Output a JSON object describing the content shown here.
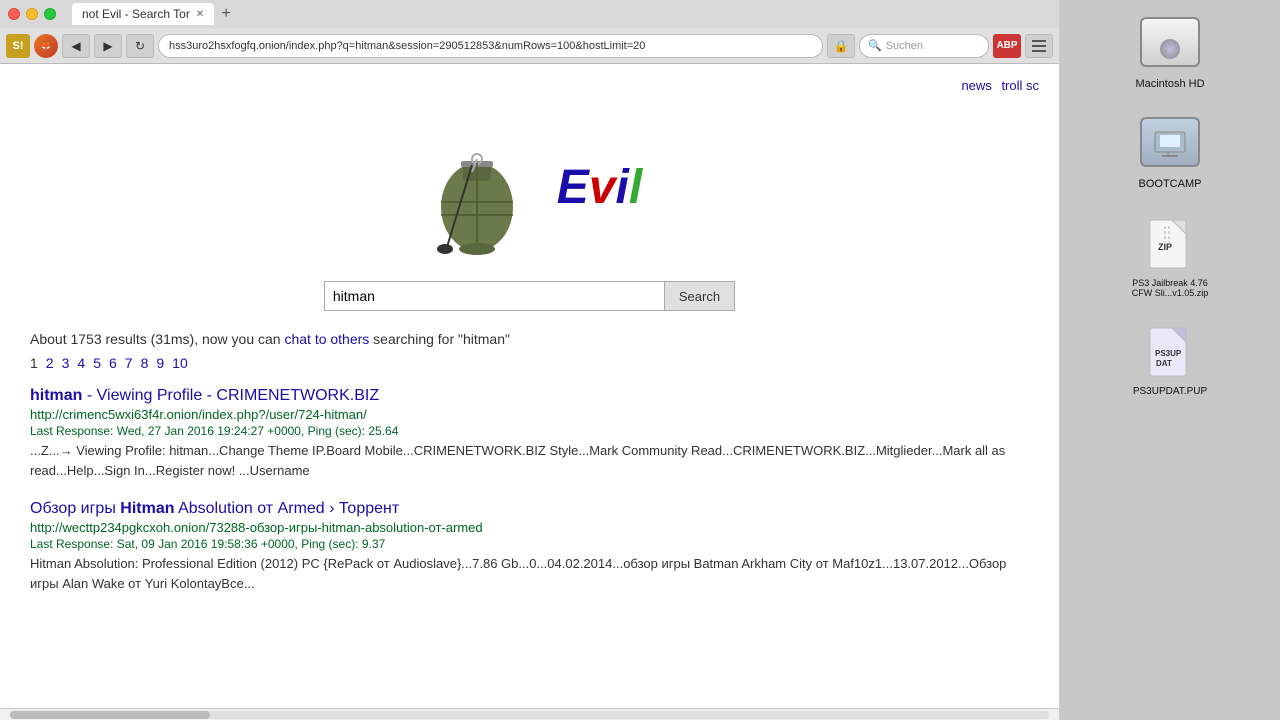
{
  "browser": {
    "title": "not Evil - Search Tor",
    "tab_label": "not Evil - Search Tor",
    "url": "hss3uro2hsxfogfq.onion/index.php?q=hitman&session=290512853&numRows=100&hostLimit=20",
    "search_placeholder": "Suchen"
  },
  "top_links": [
    "news",
    "troll sc"
  ],
  "search": {
    "query": "hitman",
    "button_label": "Search",
    "evil_letters": [
      "E",
      "v",
      "i",
      "l"
    ]
  },
  "results": {
    "summary": "About 1753 results (31ms), now you can ",
    "chat_link_text": "chat to others",
    "summary_suffix": " searching for \"hitman\"",
    "pagination": [
      "1",
      "2",
      "3",
      "4",
      "5",
      "6",
      "7",
      "8",
      "9",
      "10"
    ],
    "current_page": "1",
    "items": [
      {
        "title_highlight": "hitman",
        "title_rest": " - Viewing Profile - CRIMENETWORK.BIZ",
        "url": "http://crimenc5wxi63f4r.onion/index.php?/user/724-hitman/",
        "meta": "Last Response: Wed, 27 Jan 2016 19:24:27 +0000, Ping (sec): 25.64",
        "description": "...Z...→ Viewing Profile: hitman...Change Theme IP.Board Mobile...CRIMENETWORK.BIZ Style...Mark Community Read...CRIMENETWORK.BIZ...Mitglieder...Mark all as read...Help...Sign In...Register now! ...Username"
      },
      {
        "title_highlight": "Hitman",
        "title_prefix": "Обзор игры ",
        "title_rest": " Absolution от Armed › Торрент",
        "url": "http://wecttp234pgkcxoh.onion/73288-обзор-игры-hitman-absolution-от-armed",
        "meta": "Last Response: Sat, 09 Jan 2016 19:58:36 +0000, Ping (sec): 9.37",
        "description": "Hitman Absolution: Professional Edition (2012) PC {RePack от Audioslave}...7.86 Gb...0...04.02.2014...обзор игры Batman Arkham City от Maf10z1...13.07.2012...Обзор игры Alan Wake от Yuri KolontayВce..."
      }
    ]
  },
  "desktop": {
    "icons": [
      {
        "label": "Macintosh HD",
        "type": "hdd"
      },
      {
        "label": "BOOTCAMP",
        "type": "bootcamp"
      },
      {
        "label": "PS3 Jailbreak 4.76 CFW Sli...v1.05.zip",
        "type": "zip"
      },
      {
        "label": "PS3UPDAT.PUP",
        "type": "pup"
      }
    ]
  }
}
